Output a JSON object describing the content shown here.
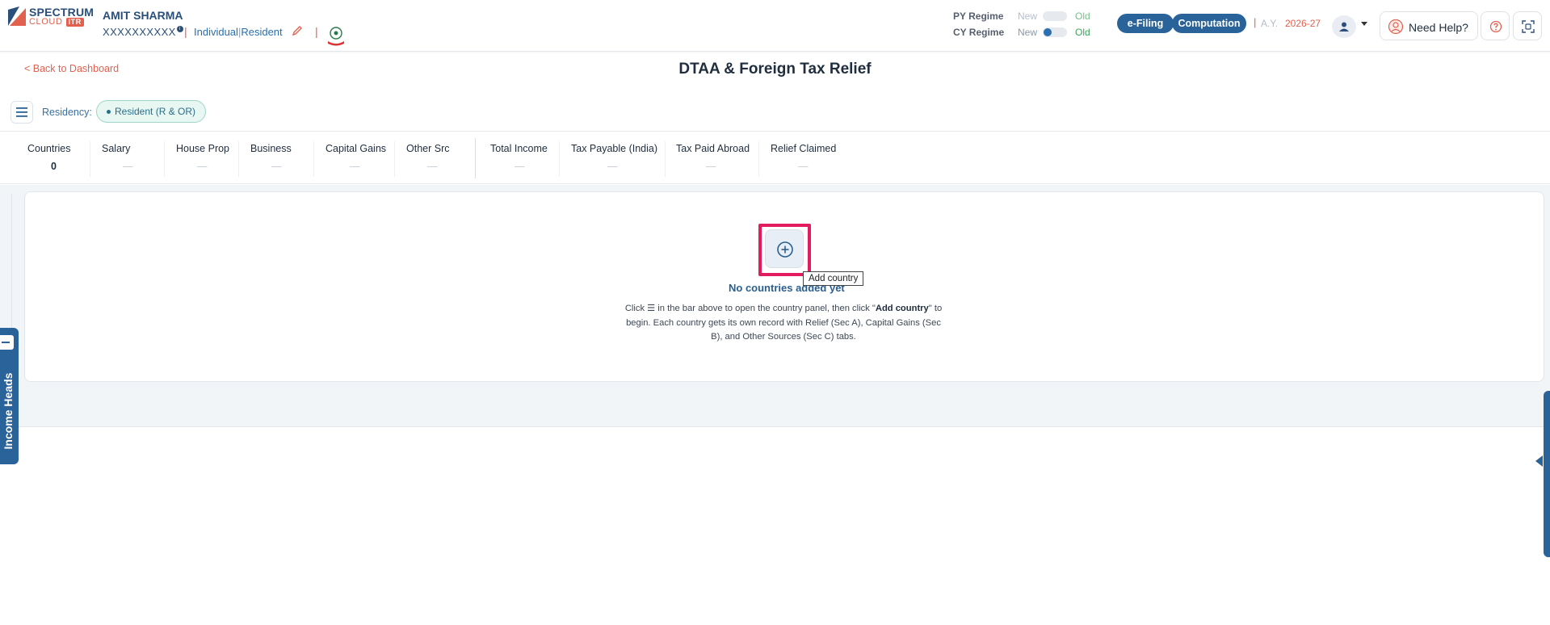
{
  "brand": {
    "line1": "SPECTRUM",
    "line2": "CLOUD",
    "tag": "ITR"
  },
  "user": {
    "name": "AMIT SHARMA",
    "pan": "XXXXXXXXXX",
    "info_badge": "i",
    "category": "Individual",
    "residency": "Resident",
    "sep": "|"
  },
  "regimes": {
    "py": {
      "label": "PY Regime",
      "new": "New",
      "old": "Old"
    },
    "cy": {
      "label": "CY Regime",
      "new": "New",
      "old": "Old"
    }
  },
  "header_buttons": {
    "efiling": "e-Filing",
    "computation": "Computation",
    "ay_label": "A.Y.",
    "ay_value": "2026-27",
    "need_help": "Need Help?"
  },
  "page": {
    "back_link": "< Back to Dashboard",
    "title": "DTAA & Foreign Tax Relief",
    "residency_label": "Residency:",
    "residency_value": "Resident (R & OR)"
  },
  "stats": [
    {
      "label": "Countries",
      "value": "0"
    },
    {
      "label": "Salary",
      "value": "—"
    },
    {
      "label": "House Prop",
      "value": "—"
    },
    {
      "label": "Business",
      "value": "—"
    },
    {
      "label": "Capital Gains",
      "value": "—"
    },
    {
      "label": "Other Src",
      "value": "—"
    },
    {
      "label": "Total Income",
      "value": "—"
    },
    {
      "label": "Tax Payable (India)",
      "value": "—"
    },
    {
      "label": "Tax Paid Abroad",
      "value": "—"
    },
    {
      "label": "Relief Claimed",
      "value": "—"
    }
  ],
  "empty_state": {
    "title": "No countries added yet",
    "tooltip": "Add country",
    "desc_part1": "Click ☰ in the bar above to open the country panel, then click \"",
    "desc_bold": "Add country",
    "desc_part2": "\" to begin. Each country gets its own record with Relief (Sec A), Capital Gains (Sec B), and Other Sources (Sec C) tabs."
  },
  "side_tab": {
    "label": "Income Heads"
  },
  "colors": {
    "primary": "#2a6399",
    "accent": "#e2604e",
    "highlight": "#e31b5f",
    "success": "#3aa55a"
  },
  "icons": {
    "menu": "hamburger-icon",
    "add": "plus-circle-icon",
    "edit": "pencil-icon",
    "user": "user-icon",
    "help": "question-circle-icon",
    "scan": "scan-icon"
  }
}
